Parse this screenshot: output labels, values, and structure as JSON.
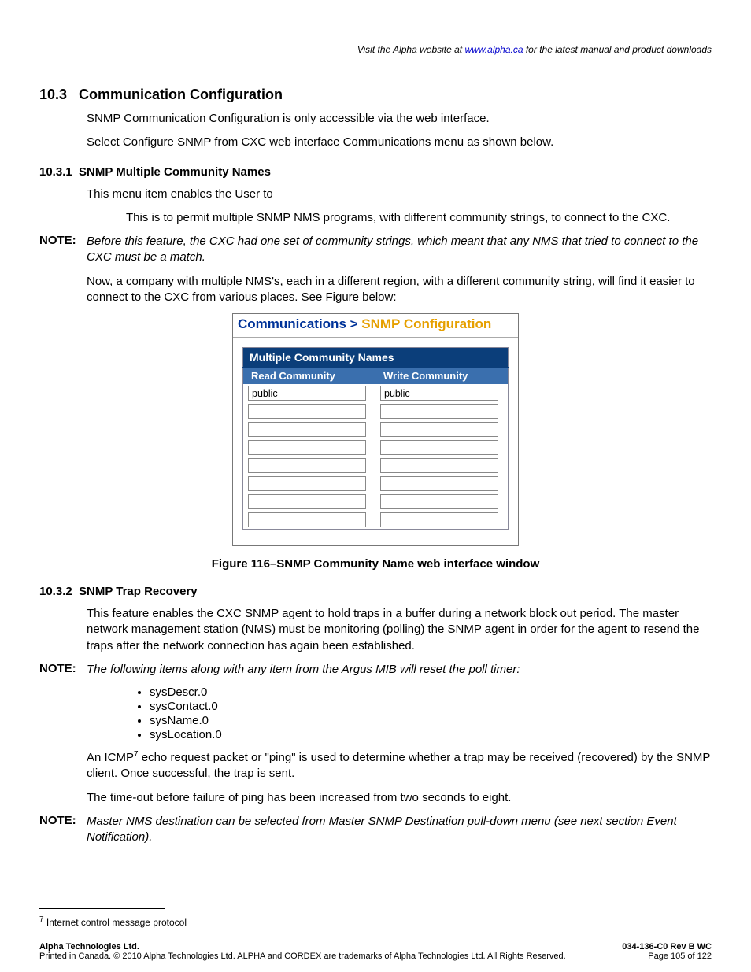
{
  "header": {
    "prefix": "Visit the Alpha website at ",
    "link_text": "www.alpha.ca",
    "suffix": " for the latest manual and product downloads"
  },
  "sec103": {
    "num": "10.3",
    "title": "Communication Configuration",
    "p1": "SNMP Communication Configuration is only accessible via the web interface.",
    "p2": "Select Configure SNMP from CXC web interface Communications menu as shown below."
  },
  "sec1031": {
    "num": "10.3.1",
    "title": "SNMP Multiple Community Names",
    "p1": "This menu item enables the User to",
    "p2": "This is to permit multiple SNMP NMS programs, with different community strings, to connect to the CXC.",
    "note": "Before this feature, the CXC had one set of community strings, which meant that any NMS that tried to connect to the CXC must be a match.",
    "p3": "Now, a company with multiple NMS's, each in a different region, with a different community string, will find it easier to connect to the CXC from various places. See Figure below:"
  },
  "panel": {
    "bc1": "Communications > ",
    "bc2": "SNMP Configuration",
    "group": "Multiple Community Names",
    "col_read": "Read Community",
    "col_write": "Write Community",
    "rows": [
      {
        "read": "public",
        "write": "public"
      },
      {
        "read": "",
        "write": ""
      },
      {
        "read": "",
        "write": ""
      },
      {
        "read": "",
        "write": ""
      },
      {
        "read": "",
        "write": ""
      },
      {
        "read": "",
        "write": ""
      },
      {
        "read": "",
        "write": ""
      },
      {
        "read": "",
        "write": ""
      }
    ]
  },
  "fig_caption": "Figure 116–SNMP Community Name web interface window",
  "sec1032": {
    "num": "10.3.2",
    "title": "SNMP Trap Recovery",
    "p1": "This feature enables the CXC SNMP agent to hold traps in a buffer during a network block out period. The master network management station (NMS) must be monitoring (polling) the SNMP agent in order for the agent to resend the traps after the network connection has again been established.",
    "note1": "The following items along with any item from the Argus MIB will reset the poll timer:",
    "bullets": [
      "sysDescr.0",
      "sysContact.0",
      "sysName.0",
      "sysLocation.0"
    ],
    "p2a": "An ICMP",
    "p2sup": "7",
    "p2b": " echo request packet or \"ping\" is used to determine whether a trap may be received (recovered) by the SNMP client. Once successful, the trap is sent.",
    "p3": "The time-out before failure of ping has been increased from two seconds to eight.",
    "note2": "Master NMS destination can be selected from Master SNMP Destination pull-down menu (see next section Event Notification)."
  },
  "note_label": "NOTE:",
  "footnote": {
    "sup": "7",
    "text": " Internet control message protocol"
  },
  "footer": {
    "left_bold": "Alpha Technologies Ltd.",
    "left_line2": "Printed in Canada.  © 2010 Alpha Technologies Ltd.  ALPHA and CORDEX are trademarks of Alpha Technologies Ltd.  All Rights Reserved.",
    "right_bold": "034-136-C0  Rev B  WC",
    "right_line2": "Page 105 of 122"
  }
}
